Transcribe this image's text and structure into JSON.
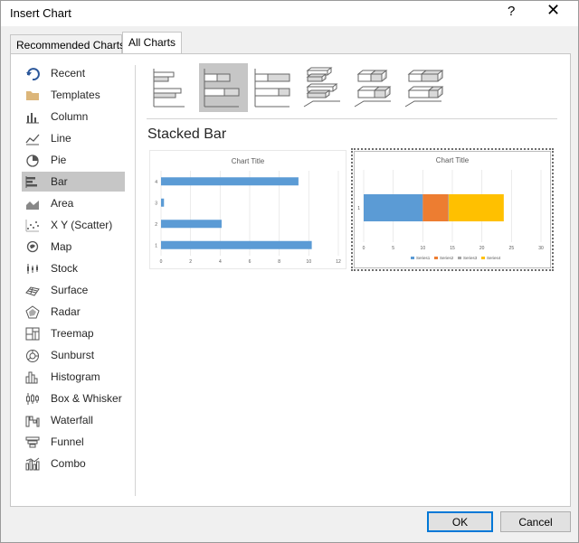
{
  "window": {
    "title": "Insert Chart",
    "help_glyph": "?",
    "close_glyph": "✕"
  },
  "tabs": [
    {
      "label": "Recommended Charts",
      "active": false
    },
    {
      "label": "All Charts",
      "active": true
    }
  ],
  "sidebar": {
    "items": [
      {
        "label": "Recent",
        "icon": "recent-icon"
      },
      {
        "label": "Templates",
        "icon": "folder-icon"
      },
      {
        "label": "Column",
        "icon": "column-chart-icon"
      },
      {
        "label": "Line",
        "icon": "line-chart-icon"
      },
      {
        "label": "Pie",
        "icon": "pie-chart-icon"
      },
      {
        "label": "Bar",
        "icon": "bar-chart-icon",
        "selected": true
      },
      {
        "label": "Area",
        "icon": "area-chart-icon"
      },
      {
        "label": "X Y (Scatter)",
        "icon": "scatter-chart-icon"
      },
      {
        "label": "Map",
        "icon": "map-chart-icon"
      },
      {
        "label": "Stock",
        "icon": "stock-chart-icon"
      },
      {
        "label": "Surface",
        "icon": "surface-chart-icon"
      },
      {
        "label": "Radar",
        "icon": "radar-chart-icon"
      },
      {
        "label": "Treemap",
        "icon": "treemap-icon"
      },
      {
        "label": "Sunburst",
        "icon": "sunburst-icon"
      },
      {
        "label": "Histogram",
        "icon": "histogram-icon"
      },
      {
        "label": "Box & Whisker",
        "icon": "box-whisker-icon"
      },
      {
        "label": "Waterfall",
        "icon": "waterfall-icon"
      },
      {
        "label": "Funnel",
        "icon": "funnel-icon"
      },
      {
        "label": "Combo",
        "icon": "combo-chart-icon"
      }
    ]
  },
  "subtypes": [
    {
      "name": "clustered-bar"
    },
    {
      "name": "stacked-bar",
      "selected": true
    },
    {
      "name": "100-stacked-bar"
    },
    {
      "name": "3d-clustered-bar"
    },
    {
      "name": "3d-stacked-bar"
    },
    {
      "name": "3d-100-stacked-bar"
    }
  ],
  "selected_chart_name": "Stacked Bar",
  "chart_data": [
    {
      "type": "bar",
      "title": "Chart Title",
      "categories": [
        "1",
        "2",
        "3",
        "4"
      ],
      "values": [
        10.2,
        4.1,
        0.2,
        9.3
      ],
      "xlim": [
        0,
        12
      ],
      "xticks": [
        "0",
        "2",
        "4",
        "6",
        "8",
        "10",
        "12"
      ],
      "orientation": "horizontal",
      "grid": true,
      "color": "#5b9bd5"
    },
    {
      "type": "bar",
      "title": "Chart Title",
      "stacked": true,
      "orientation": "horizontal",
      "categories": [
        "1"
      ],
      "series": [
        {
          "name": "Series1",
          "values": [
            10
          ],
          "color": "#5b9bd5"
        },
        {
          "name": "Series2",
          "values": [
            4.3
          ],
          "color": "#ed7d31"
        },
        {
          "name": "Series3",
          "values": [
            0.1
          ],
          "color": "#a5a5a5"
        },
        {
          "name": "Series4",
          "values": [
            9.3
          ],
          "color": "#ffc000"
        }
      ],
      "xlim": [
        0,
        30
      ],
      "xticks": [
        "0",
        "5",
        "10",
        "15",
        "20",
        "25",
        "30"
      ],
      "legend": "bottom",
      "grid": true
    }
  ],
  "buttons": {
    "ok": "OK",
    "cancel": "Cancel"
  }
}
